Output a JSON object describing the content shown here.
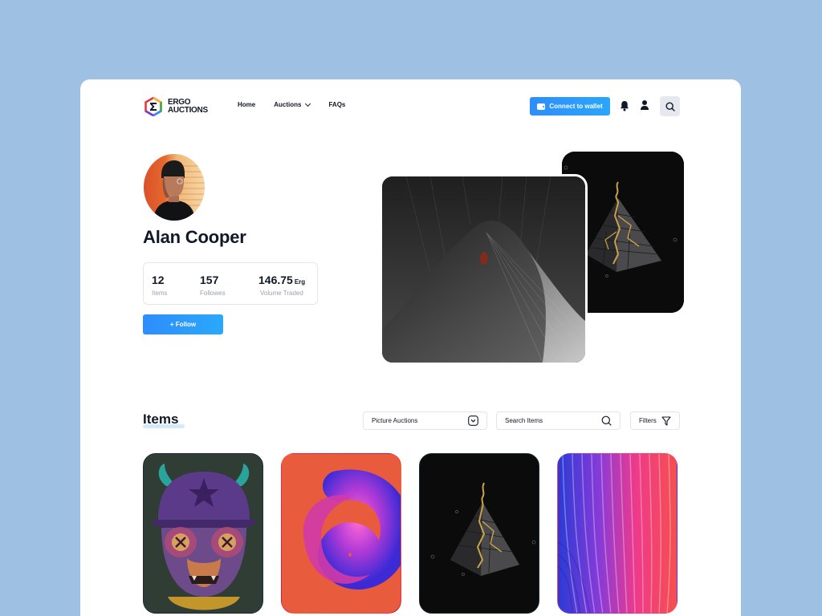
{
  "header": {
    "logo": {
      "line1": "ERGO",
      "line2": "AUCTIONS"
    },
    "nav": [
      {
        "label": "Home"
      },
      {
        "label": "Auctions"
      },
      {
        "label": "FAQs"
      }
    ],
    "wallet_button": "Connect to wallet"
  },
  "profile": {
    "name": "Alan Cooper",
    "stats": {
      "items": {
        "value": "12",
        "label": "Items"
      },
      "followers": {
        "value": "157",
        "label": "Followes"
      },
      "volume": {
        "value": "146.75",
        "unit": "Erg",
        "label": "Volume Traded"
      }
    },
    "follow_button": "+ Follow"
  },
  "items_section": {
    "title": "Items",
    "category_select": "Picture Auctions",
    "search_placeholder": "Search Items",
    "filters_label": "Filters"
  },
  "colors": {
    "background": "#9ec0e2",
    "accent": "#2e8dfb",
    "text": "#111827",
    "muted": "#9aa1af"
  }
}
